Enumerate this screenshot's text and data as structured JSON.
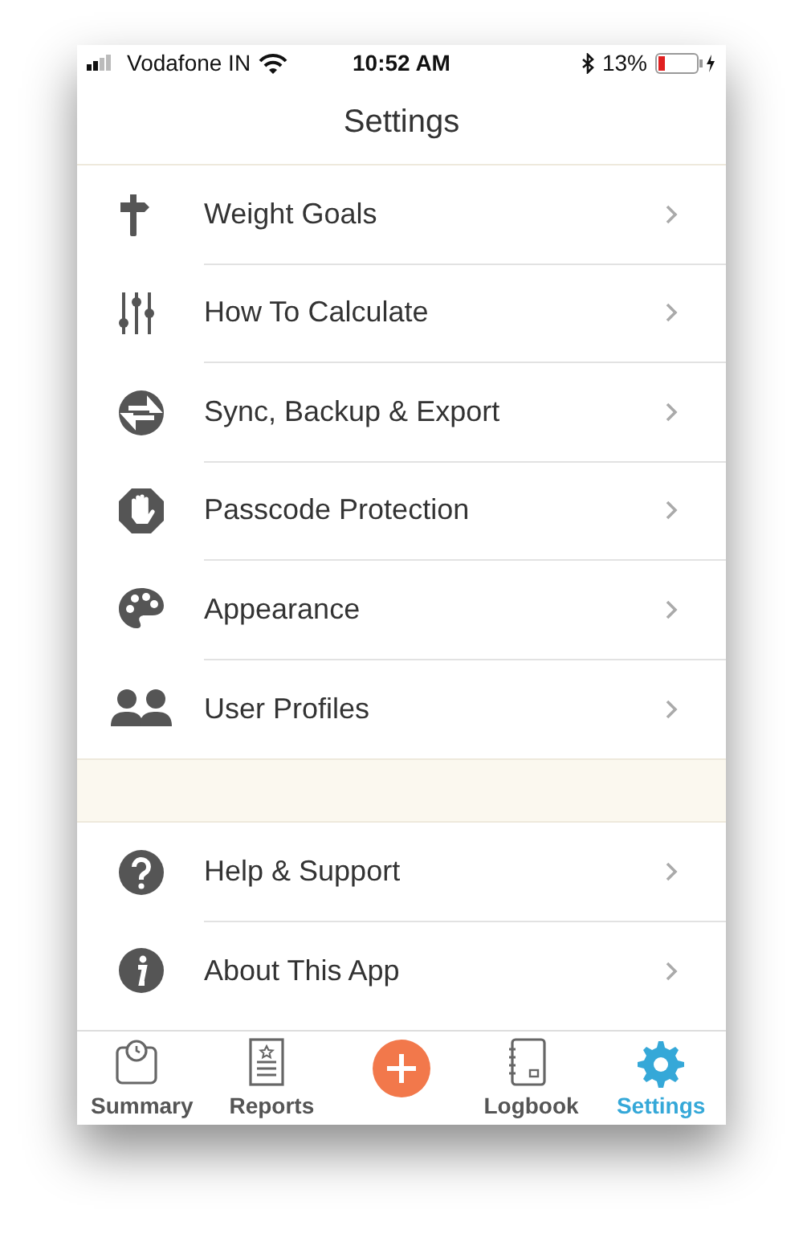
{
  "status_bar": {
    "carrier": "Vodafone IN",
    "time": "10:52 AM",
    "battery": "13%"
  },
  "title": "Settings",
  "sections": [
    {
      "items": [
        {
          "label": "Weight Goals"
        },
        {
          "label": "How To Calculate"
        },
        {
          "label": "Sync, Backup & Export"
        },
        {
          "label": "Passcode Protection"
        },
        {
          "label": "Appearance"
        },
        {
          "label": "User Profiles"
        }
      ]
    },
    {
      "items": [
        {
          "label": "Help & Support"
        },
        {
          "label": "About This App"
        }
      ]
    }
  ],
  "tab_bar": [
    {
      "kind": "tab",
      "label": "Summary",
      "selected": false
    },
    {
      "kind": "tab",
      "label": "Reports",
      "selected": false
    },
    {
      "kind": "add"
    },
    {
      "kind": "tab",
      "label": "Logbook",
      "selected": false
    },
    {
      "kind": "tab",
      "label": "Settings",
      "selected": true
    }
  ]
}
